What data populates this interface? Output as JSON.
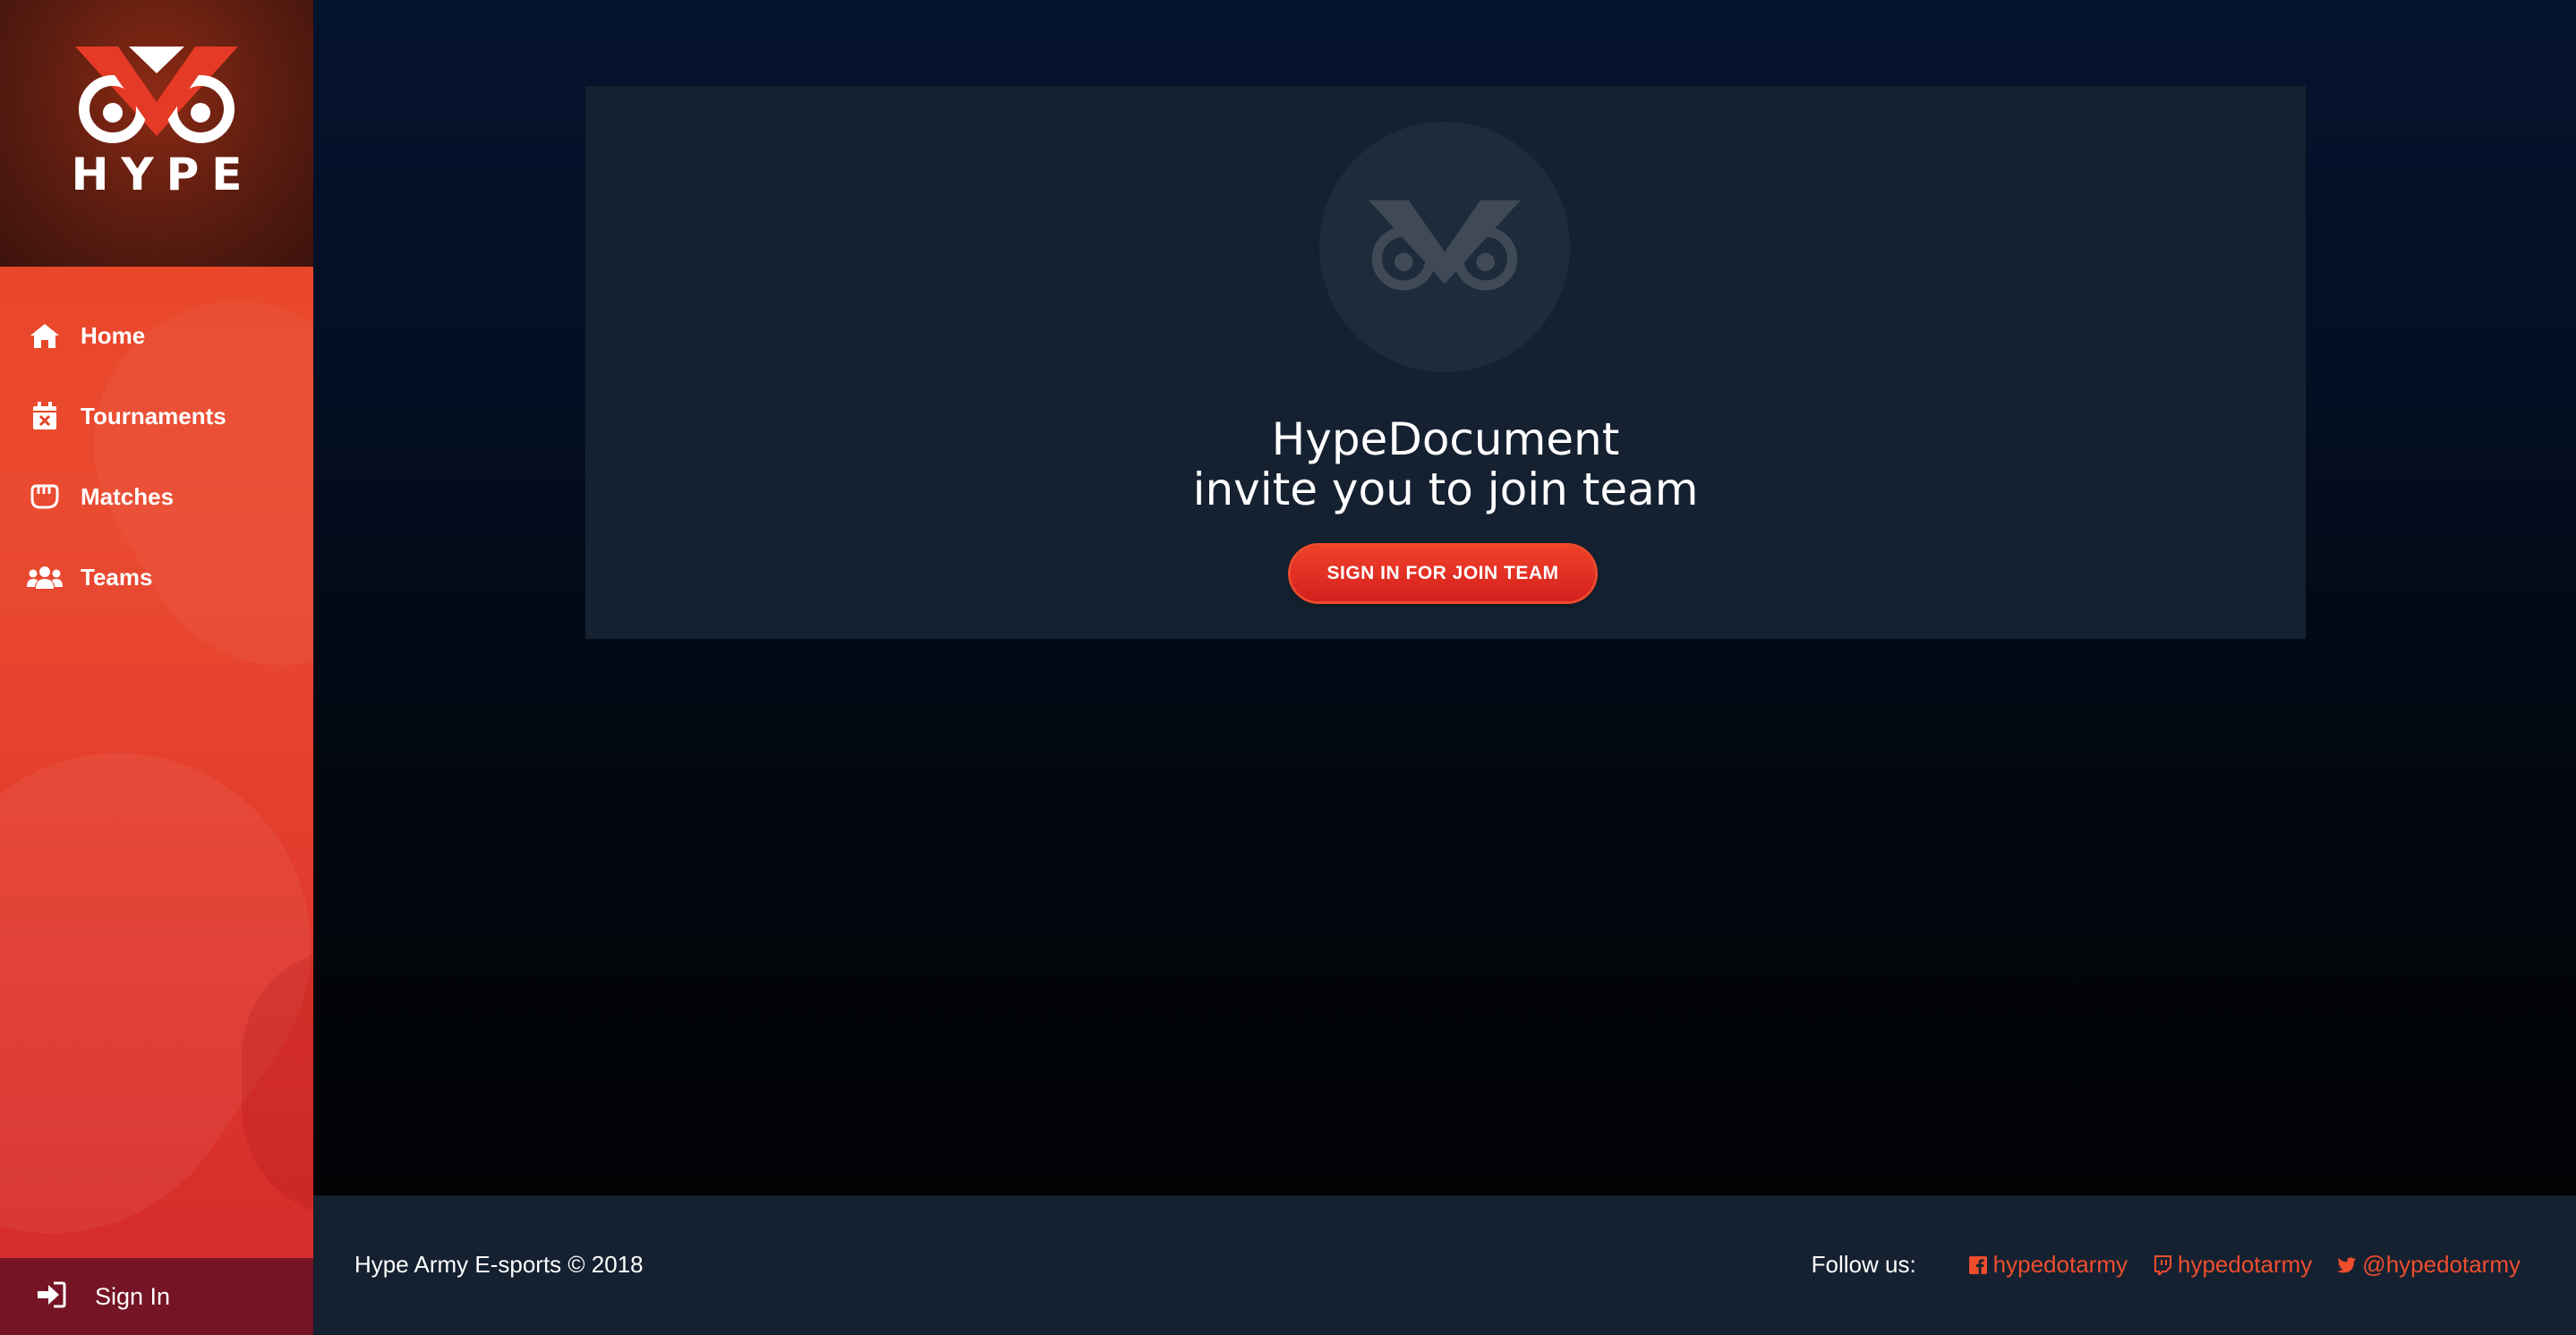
{
  "brand": {
    "name": "HYPE"
  },
  "nav": {
    "items": [
      {
        "label": "Home",
        "icon": "home-icon"
      },
      {
        "label": "Tournaments",
        "icon": "calendar-icon"
      },
      {
        "label": "Matches",
        "icon": "fist-icon"
      },
      {
        "label": "Teams",
        "icon": "users-icon"
      }
    ]
  },
  "signin": {
    "label": "Sign In",
    "icon": "sign-in-icon"
  },
  "invite": {
    "team_name": "HypeDocument",
    "message": "invite you to join team",
    "button_label": "SIGN IN FOR JOIN TEAM"
  },
  "footer": {
    "copyright": "Hype Army E-sports © 2018",
    "follow_label": "Follow us:",
    "socials": [
      {
        "network": "facebook",
        "icon": "facebook-icon",
        "handle": "hypedotarmy"
      },
      {
        "network": "twitch",
        "icon": "twitch-icon",
        "handle": "hypedotarmy"
      },
      {
        "network": "twitter",
        "icon": "twitter-icon",
        "handle": "@hypedotarmy"
      }
    ]
  },
  "colors": {
    "accent": "#ee4d2e",
    "sidebar_top": "#e84424",
    "sidebar_bottom": "#d32a2a",
    "brand_bg": "#5a1c10",
    "signin_bg": "#741424",
    "card_bg": "#152130",
    "main_bg": "#04132e"
  }
}
